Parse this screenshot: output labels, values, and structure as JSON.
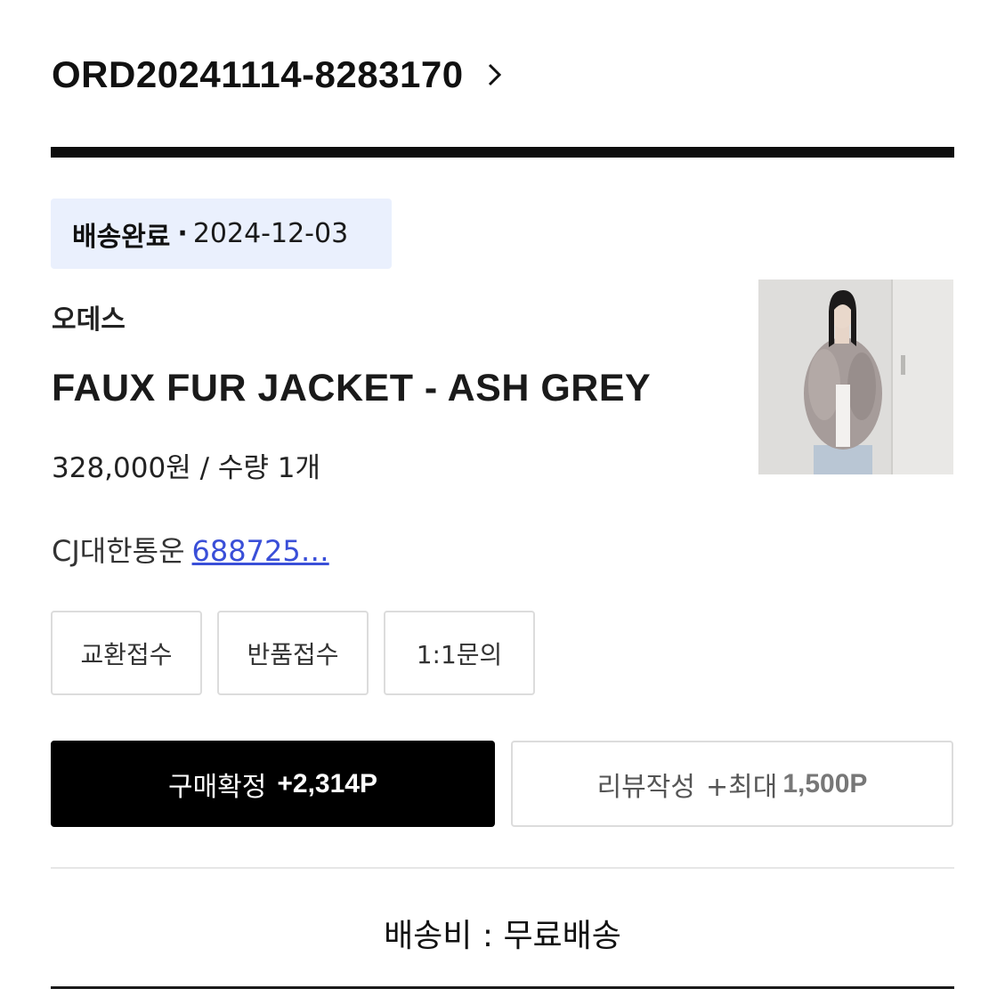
{
  "order": {
    "id": "ORD20241114-8283170",
    "chevron_icon": "chevron-right-icon"
  },
  "status": {
    "label": "배송완료",
    "separator": "·",
    "date": "2024-12-03"
  },
  "product": {
    "brand": "오데스",
    "name": "FAUX FUR JACKET - ASH GREY",
    "price": "328,000원 / 수량 1개",
    "image_icon": "product-photo"
  },
  "shipping": {
    "carrier": "CJ대한통운",
    "tracking": "688725…"
  },
  "actions": {
    "exchange": "교환접수",
    "return": "반품접수",
    "inquiry": "1:1문의",
    "confirm_label": "구매확정",
    "confirm_points": "+2,314P",
    "review_label": "리뷰작성",
    "review_prefix": "+최대",
    "review_points": "1,500P"
  },
  "delivery_fee": "배송비 : 무료배송",
  "colors": {
    "accent_link": "#3a4fd8",
    "badge_bg": "#eaf0fd",
    "primary_button": "#000000"
  }
}
